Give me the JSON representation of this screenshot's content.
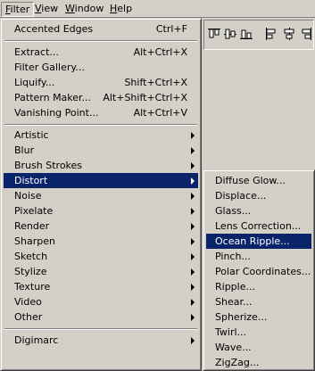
{
  "menubar": {
    "items": [
      {
        "label": "Filter",
        "mnemonic": "F",
        "rest": "ilter"
      },
      {
        "label": "View",
        "mnemonic": "V",
        "rest": "iew"
      },
      {
        "label": "Window",
        "mnemonic": "W",
        "rest": "indow"
      },
      {
        "label": "Help",
        "mnemonic": "H",
        "rest": "elp"
      }
    ]
  },
  "filter_menu": {
    "last_filter": {
      "label": "Accented Edges",
      "accel": "Ctrl+F"
    },
    "group1": [
      {
        "label": "Extract...",
        "accel": "Alt+Ctrl+X"
      },
      {
        "label": "Filter Gallery...",
        "accel": ""
      },
      {
        "label": "Liquify...",
        "accel": "Shift+Ctrl+X"
      },
      {
        "label": "Pattern Maker...",
        "accel": "Alt+Shift+Ctrl+X"
      },
      {
        "label": "Vanishing Point...",
        "accel": "Alt+Ctrl+V"
      }
    ],
    "group2": [
      {
        "label": "Artistic"
      },
      {
        "label": "Blur"
      },
      {
        "label": "Brush Strokes"
      },
      {
        "label": "Distort"
      },
      {
        "label": "Noise"
      },
      {
        "label": "Pixelate"
      },
      {
        "label": "Render"
      },
      {
        "label": "Sharpen"
      },
      {
        "label": "Sketch"
      },
      {
        "label": "Stylize"
      },
      {
        "label": "Texture"
      },
      {
        "label": "Video"
      },
      {
        "label": "Other"
      }
    ],
    "group3": [
      {
        "label": "Digimarc"
      }
    ]
  },
  "distort_submenu": {
    "items": [
      {
        "label": "Diffuse Glow..."
      },
      {
        "label": "Displace..."
      },
      {
        "label": "Glass..."
      },
      {
        "label": "Lens Correction..."
      },
      {
        "label": "Ocean Ripple..."
      },
      {
        "label": "Pinch..."
      },
      {
        "label": "Polar Coordinates..."
      },
      {
        "label": "Ripple..."
      },
      {
        "label": "Shear..."
      },
      {
        "label": "Spherize..."
      },
      {
        "label": "Twirl..."
      },
      {
        "label": "Wave..."
      },
      {
        "label": "ZigZag..."
      }
    ]
  },
  "toolbar": {
    "icons": [
      "align-top-icon",
      "align-vertical-center-icon",
      "align-bottom-icon",
      "align-left-icon",
      "align-horizontal-center-icon",
      "align-right-icon"
    ]
  },
  "colors": {
    "face": "#d4d0c8",
    "highlight": "#0a246a",
    "highlight_text": "#ffffff"
  }
}
